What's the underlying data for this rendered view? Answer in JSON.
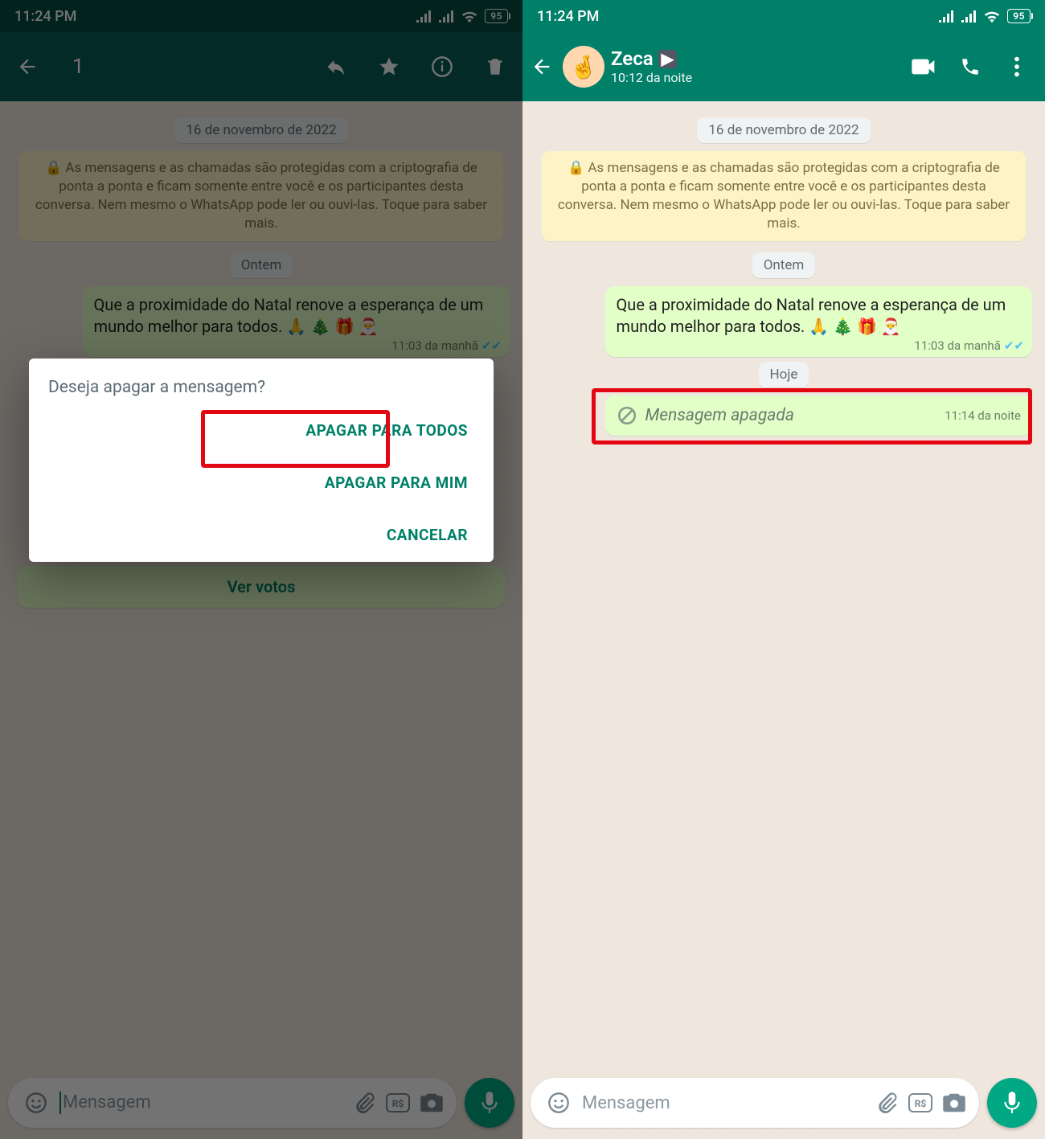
{
  "status": {
    "time": "11:24 PM",
    "battery": "95"
  },
  "left": {
    "selection_count": "1",
    "date1": "16 de novembro de 2022",
    "encryption_note": "As mensagens e as chamadas são protegidas com a criptografia de ponta a ponta e ficam somente entre você e os participantes desta conversa. Nem mesmo o WhatsApp pode ler ou ouvi-las. Toque para saber mais.",
    "date2": "Ontem",
    "msg1_text": "Que a proximidade do Natal renove a esperança de um mundo melhor para todos. 🙏 🎄 🎁 🎅",
    "msg1_time": "11:03 da manhã",
    "poll_votes_label": "Ver votos",
    "dialog": {
      "title": "Deseja apagar a mensagem?",
      "delete_all": "APAGAR PARA TODOS",
      "delete_me": "APAGAR PARA MIM",
      "cancel": "CANCELAR"
    },
    "input_placeholder": "Mensagem"
  },
  "right": {
    "contact_name": "Zeca",
    "contact_sub": "10:12 da noite",
    "date1": "16 de novembro de 2022",
    "encryption_note": "As mensagens e as chamadas são protegidas com a criptografia de ponta a ponta e ficam somente entre você e os participantes desta conversa. Nem mesmo o WhatsApp pode ler ou ouvi-las. Toque para saber mais.",
    "date2": "Ontem",
    "msg1_text": "Que a proximidade do Natal renove a esperança de um mundo melhor para todos. 🙏 🎄 🎁 🎅",
    "msg1_time": "11:03 da manhã",
    "date3": "Hoje",
    "deleted_text": "Mensagem apagada",
    "deleted_time": "11:14 da noite",
    "input_placeholder": "Mensagem"
  }
}
